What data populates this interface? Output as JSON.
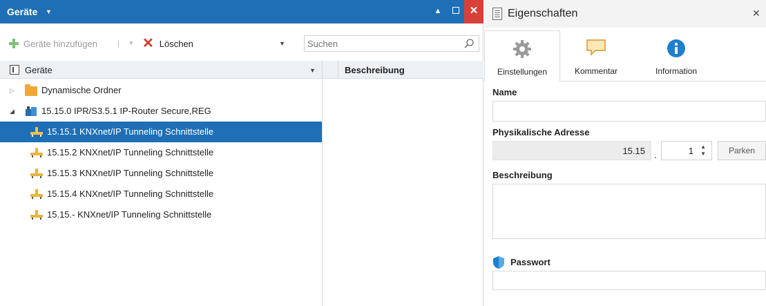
{
  "left_panel": {
    "title": "Geräte",
    "toolbar": {
      "add_label": "Geräte hinzufügen",
      "separator": "|",
      "delete_label": "Löschen"
    },
    "search": {
      "placeholder": "Suchen"
    },
    "tree_header": "Geräte",
    "description_header": "Beschreibung",
    "tree": [
      {
        "label": "Dynamische Ordner",
        "type": "folder",
        "selected": false
      },
      {
        "label": "15.15.0 IPR/S3.5.1 IP-Router Secure,REG",
        "type": "router",
        "selected": false
      },
      {
        "label": "15.15.1 KNXnet/IP Tunneling Schnittstelle",
        "type": "device",
        "selected": true
      },
      {
        "label": "15.15.2 KNXnet/IP Tunneling Schnittstelle",
        "type": "device",
        "selected": false
      },
      {
        "label": "15.15.3 KNXnet/IP Tunneling Schnittstelle",
        "type": "device",
        "selected": false
      },
      {
        "label": "15.15.4 KNXnet/IP Tunneling Schnittstelle",
        "type": "device",
        "selected": false
      },
      {
        "label": "15.15.- KNXnet/IP Tunneling Schnittstelle",
        "type": "device",
        "selected": false
      }
    ]
  },
  "properties": {
    "title": "Eigenschaften",
    "tabs": [
      {
        "label": "Einstellungen",
        "icon": "gear-icon",
        "active": true
      },
      {
        "label": "Kommentar",
        "icon": "comment-icon",
        "active": false
      },
      {
        "label": "Information",
        "icon": "info-icon",
        "active": false
      }
    ],
    "name_label": "Name",
    "name_value": "",
    "address_label": "Physikalische Adresse",
    "address_prefix": "15.15",
    "address_dot": ".",
    "address_device": "1",
    "park_label": "Parken",
    "description_label": "Beschreibung",
    "description_value": "",
    "password_label": "Passwort",
    "password_value": ""
  },
  "colors": {
    "accent": "#1e6fb5",
    "close": "#d8403a",
    "delete": "#d23a2c",
    "add": "#7ec07a",
    "folder": "#f0a73a"
  }
}
